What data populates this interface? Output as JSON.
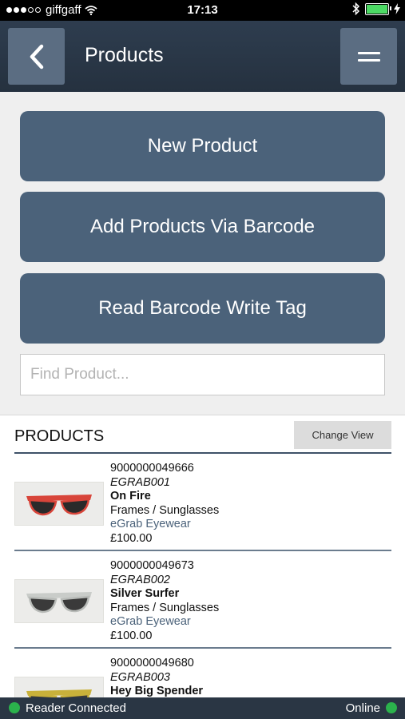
{
  "status_bar": {
    "carrier": "giffgaff",
    "time": "17:13"
  },
  "header": {
    "title": "Products",
    "back_icon": "chevron-left-icon",
    "menu_icon": "hamburger-menu-icon"
  },
  "actions": {
    "new_product": "New Product",
    "add_via_barcode": "Add Products Via Barcode",
    "read_barcode_write_tag": "Read Barcode Write Tag"
  },
  "search": {
    "placeholder": "Find Product...",
    "value": ""
  },
  "products_section": {
    "heading": "PRODUCTS",
    "change_view_label": "Change View",
    "items": [
      {
        "barcode": "9000000049666",
        "sku": "EGRAB001",
        "name": "On Fire",
        "category": "Frames / Sunglasses",
        "brand": "eGrab Eyewear",
        "price": "£100.00",
        "frame_color": "#d8453a"
      },
      {
        "barcode": "9000000049673",
        "sku": "EGRAB002",
        "name": "Silver Surfer",
        "category": "Frames / Sunglasses",
        "brand": "eGrab Eyewear",
        "price": "£100.00",
        "frame_color": "#c9ccc9"
      },
      {
        "barcode": "9000000049680",
        "sku": "EGRAB003",
        "name": "Hey Big Spender",
        "category": "",
        "brand": "",
        "price": "",
        "frame_color": "#c9b13a"
      }
    ]
  },
  "footer": {
    "reader_status": "Reader Connected",
    "online_status": "Online",
    "status_color": "#2bb24c"
  }
}
